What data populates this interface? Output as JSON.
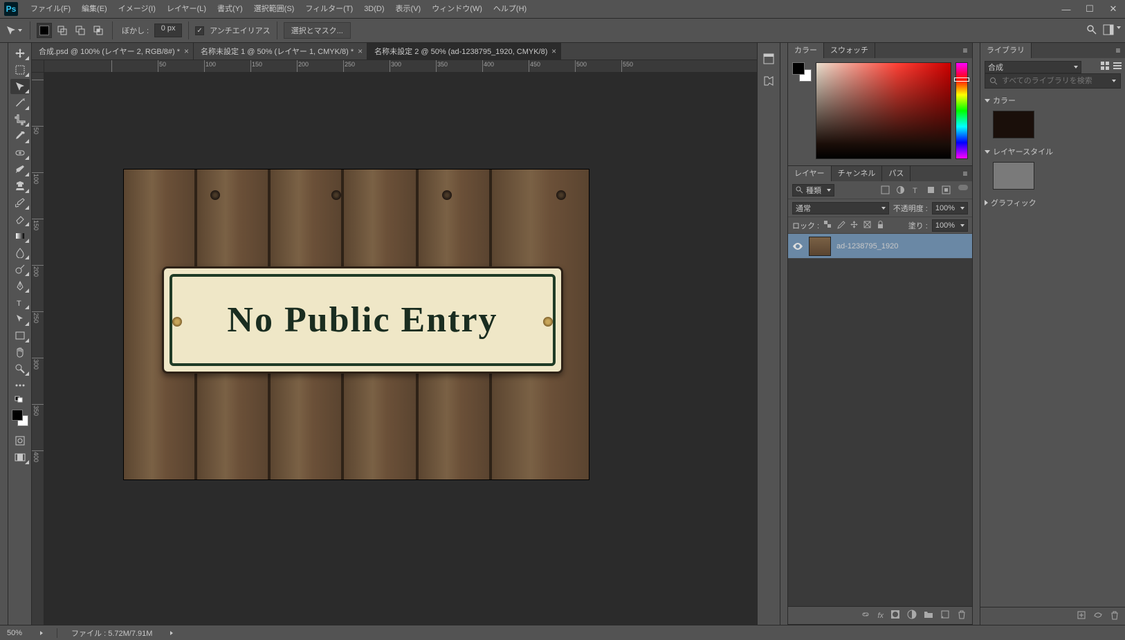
{
  "app": {
    "logo": "Ps"
  },
  "menu": [
    "ファイル(F)",
    "編集(E)",
    "イメージ(I)",
    "レイヤー(L)",
    "書式(Y)",
    "選択範囲(S)",
    "フィルター(T)",
    "3D(D)",
    "表示(V)",
    "ウィンドウ(W)",
    "ヘルプ(H)"
  ],
  "optbar": {
    "feather_label": "ぼかし :",
    "feather_value": "0 px",
    "antialias_label": "アンチエイリアス",
    "select_mask_label": "選択とマスク..."
  },
  "tabs": [
    {
      "title": "合成.psd @ 100% (レイヤー 2, RGB/8#) *"
    },
    {
      "title": "名称未設定 1 @ 50% (レイヤー 1, CMYK/8) *"
    },
    {
      "title": "名称未設定 2 @ 50% (ad-1238795_1920, CMYK/8) *",
      "active": true
    }
  ],
  "ruler_h": [
    "",
    "50",
    "100",
    "150",
    "200",
    "250",
    "300",
    "350",
    "400",
    "450",
    "500",
    "550"
  ],
  "ruler_v": [
    "",
    "50",
    "100",
    "150",
    "200",
    "250",
    "300",
    "350",
    "400"
  ],
  "canvas_image": {
    "sign_text": "No Public Entry"
  },
  "panels": {
    "color_tab": "カラー",
    "swatch_tab": "スウォッチ",
    "layers_tab": "レイヤー",
    "channels_tab": "チャンネル",
    "paths_tab": "パス",
    "kind_label": "種類",
    "blend_mode": "通常",
    "opacity_label": "不透明度 :",
    "opacity_value": "100%",
    "lock_label": "ロック :",
    "fill_label": "塗り :",
    "fill_value": "100%",
    "layer_name": "ad-1238795_1920"
  },
  "libraries": {
    "tab": "ライブラリ",
    "doc_sel": "合成",
    "search_placeholder": "すべてのライブラリを検索",
    "sec_color": "カラー",
    "sec_layerstyle": "レイヤースタイル",
    "sec_graphic": "グラフィック"
  },
  "status": {
    "zoom": "50%",
    "filesize": "ファイル : 5.72M/7.91M"
  }
}
